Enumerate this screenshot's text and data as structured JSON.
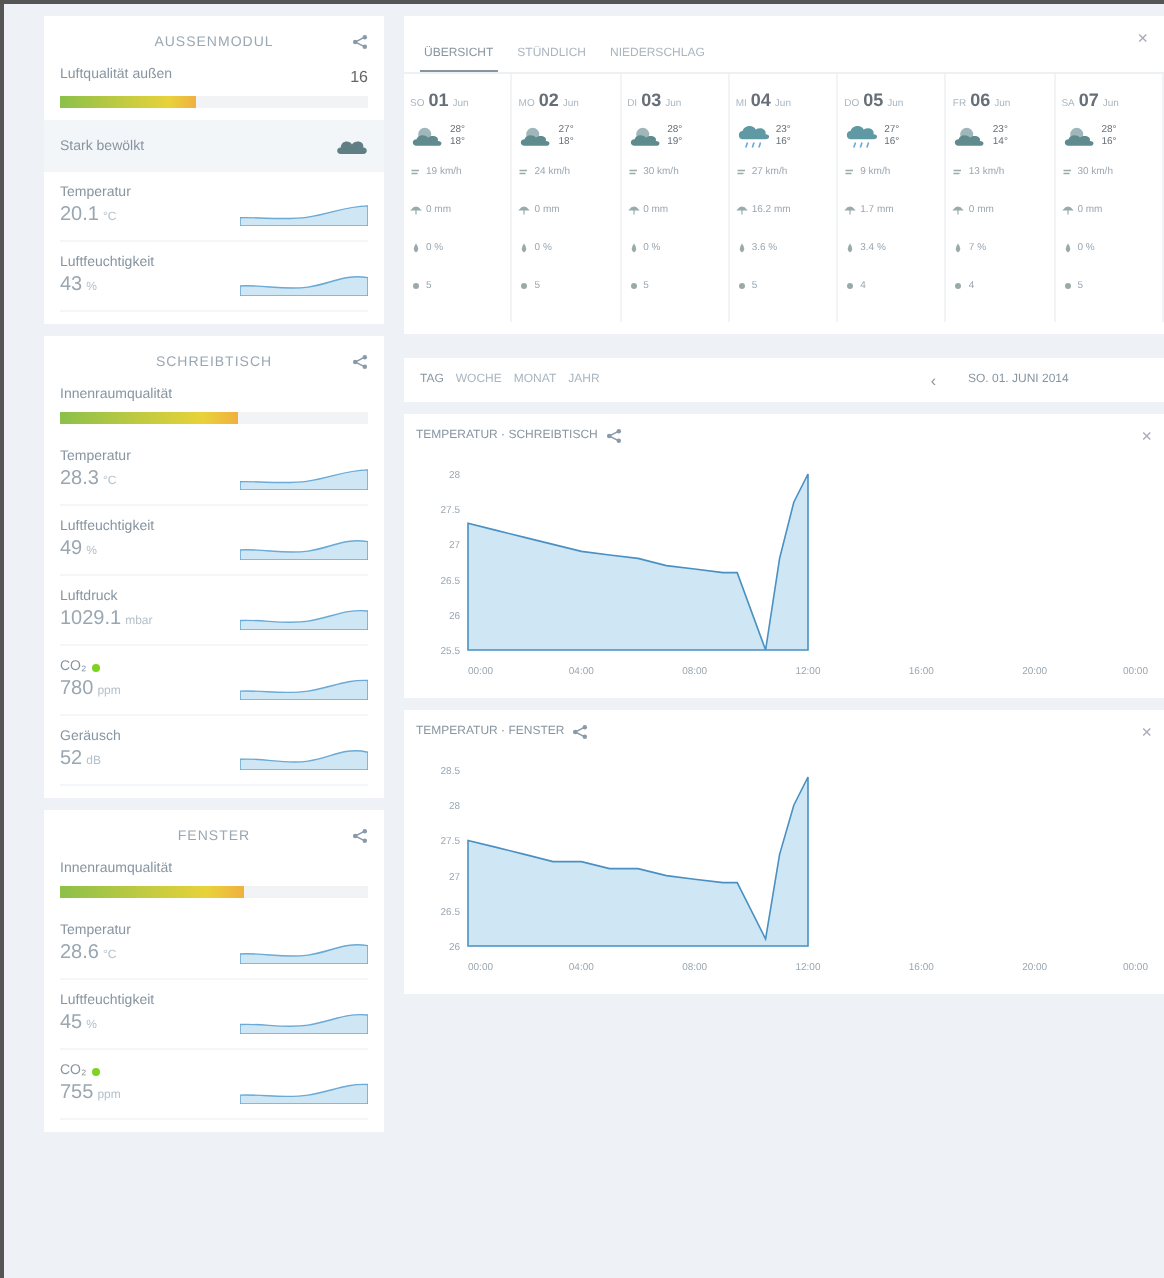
{
  "sidebar": {
    "modules": [
      {
        "title": "AUSSENMODUL",
        "rows": [
          {
            "kind": "bar",
            "label": "Luftqualität außen",
            "value": "16",
            "level": 0.44
          },
          {
            "kind": "weather",
            "label": "Stark bewölkt"
          },
          {
            "kind": "spark",
            "label": "Temperatur",
            "value": "20.1",
            "unit": "°C"
          },
          {
            "kind": "spark",
            "label": "Luftfeuchtigkeit",
            "value": "43",
            "unit": "%"
          }
        ]
      },
      {
        "title": "SCHREIBTISCH",
        "rows": [
          {
            "kind": "bar",
            "label": "Innenraumqualität",
            "level": 0.58
          },
          {
            "kind": "spark",
            "label": "Temperatur",
            "value": "28.3",
            "unit": "°C"
          },
          {
            "kind": "spark",
            "label": "Luftfeuchtigkeit",
            "value": "49",
            "unit": "%"
          },
          {
            "kind": "spark",
            "label": "Luftdruck",
            "value": "1029.1",
            "unit": "mbar"
          },
          {
            "kind": "spark",
            "label": "CO₂",
            "value": "780",
            "unit": "ppm",
            "color": "#7ed321"
          },
          {
            "kind": "spark",
            "label": "Geräusch",
            "value": "52",
            "unit": "dB"
          }
        ]
      },
      {
        "title": "FENSTER",
        "rows": [
          {
            "kind": "bar",
            "label": "Innenraumqualität",
            "level": 0.6
          },
          {
            "kind": "spark",
            "label": "Temperatur",
            "value": "28.6",
            "unit": "°C"
          },
          {
            "kind": "spark",
            "label": "Luftfeuchtigkeit",
            "value": "45",
            "unit": "%"
          },
          {
            "kind": "spark",
            "label": "CO₂",
            "value": "755",
            "unit": "ppm",
            "color": "#7ed321"
          }
        ]
      }
    ]
  },
  "forecast": {
    "tabs": [
      {
        "label": "ÜBERSICHT",
        "selected": true
      },
      {
        "label": "STÜNDLICH",
        "selected": false
      },
      {
        "label": "NIEDERSCHLAG",
        "selected": false
      }
    ],
    "close": "×",
    "days": [
      {
        "weekday": "SO",
        "day": "01",
        "month": "Jun",
        "kind": "cloud",
        "high": "28°",
        "low": "18°",
        "wind": "19 km/h",
        "rain": "0 mm",
        "humidity": "0 %",
        "uv": "5"
      },
      {
        "weekday": "MO",
        "day": "02",
        "month": "Jun",
        "kind": "cloud",
        "high": "27°",
        "low": "18°",
        "wind": "24 km/h",
        "rain": "0 mm",
        "humidity": "0 %",
        "uv": "5"
      },
      {
        "weekday": "DI",
        "day": "03",
        "month": "Jun",
        "kind": "cloud",
        "high": "28°",
        "low": "19°",
        "wind": "30 km/h",
        "rain": "0 mm",
        "humidity": "0 %",
        "uv": "5"
      },
      {
        "weekday": "MI",
        "day": "04",
        "month": "Jun",
        "kind": "rain",
        "high": "23°",
        "low": "16°",
        "wind": "27 km/h",
        "rain": "16.2 mm",
        "humidity": "3.6 %",
        "uv": "5"
      },
      {
        "weekday": "DO",
        "day": "05",
        "month": "Jun",
        "kind": "rain",
        "high": "27°",
        "low": "16°",
        "wind": "9 km/h",
        "rain": "1.7 mm",
        "humidity": "3.4 %",
        "uv": "4"
      },
      {
        "weekday": "FR",
        "day": "06",
        "month": "Jun",
        "kind": "cloud",
        "high": "23°",
        "low": "14°",
        "wind": "13 km/h",
        "rain": "0 mm",
        "humidity": "7 %",
        "uv": "4"
      },
      {
        "weekday": "SA",
        "day": "07",
        "month": "Jun",
        "kind": "cloud",
        "high": "28°",
        "low": "16°",
        "wind": "30 km/h",
        "rain": "0 mm",
        "humidity": "0 %",
        "uv": "5"
      }
    ]
  },
  "range": {
    "tabs": [
      {
        "label": "TAG",
        "selected": true
      },
      {
        "label": "WOCHE",
        "selected": false
      },
      {
        "label": "MONAT",
        "selected": false
      },
      {
        "label": "JAHR",
        "selected": false
      }
    ],
    "prev": "‹",
    "date": "SO. 01. JUNI 2014"
  },
  "charts": [
    {
      "close": "×",
      "chart_data": {
        "type": "area",
        "title": "TEMPERATUR · SCHREIBTISCH",
        "x": [
          0,
          1,
          2,
          3,
          4,
          5,
          6,
          7,
          8,
          9,
          9.5,
          10.5,
          11,
          11.5,
          12
        ],
        "series": [
          {
            "color": "#4a90c2",
            "values": [
              27.3,
              27.2,
              27.1,
              27.0,
              26.9,
              26.85,
              26.8,
              26.7,
              26.65,
              26.6,
              26.6,
              25.5,
              26.8,
              27.6,
              28.0
            ]
          }
        ],
        "xlim": [
          0,
          24
        ],
        "ylim": [
          25.5,
          28
        ],
        "yticks": [
          25.5,
          26,
          26.5,
          27,
          27.5,
          28
        ],
        "xticks": [
          {
            "value": 0,
            "label": "00:00"
          },
          {
            "value": 4,
            "label": "04:00"
          },
          {
            "value": 8,
            "label": "08:00"
          },
          {
            "value": 12,
            "label": "12:00"
          },
          {
            "value": 16,
            "label": "16:00"
          },
          {
            "value": 20,
            "label": "20:00"
          },
          {
            "value": 24,
            "label": "00:00"
          }
        ]
      }
    },
    {
      "close": "×",
      "chart_data": {
        "type": "area",
        "title": "TEMPERATUR · FENSTER",
        "x": [
          0,
          1,
          2,
          3,
          4,
          5,
          6,
          7,
          8,
          9,
          9.5,
          10.5,
          11,
          11.5,
          12
        ],
        "series": [
          {
            "color": "#4a90c2",
            "values": [
              27.5,
              27.4,
              27.3,
              27.2,
              27.2,
              27.1,
              27.1,
              27.0,
              26.95,
              26.9,
              26.9,
              26.1,
              27.3,
              28.0,
              28.4
            ]
          }
        ],
        "xlim": [
          0,
          24
        ],
        "ylim": [
          26,
          28.5
        ],
        "yticks": [
          26,
          26.5,
          27,
          27.5,
          28,
          28.5
        ],
        "xticks": [
          {
            "value": 0,
            "label": "00:00"
          },
          {
            "value": 4,
            "label": "04:00"
          },
          {
            "value": 8,
            "label": "08:00"
          },
          {
            "value": 12,
            "label": "12:00"
          },
          {
            "value": 16,
            "label": "16:00"
          },
          {
            "value": 20,
            "label": "20:00"
          },
          {
            "value": 24,
            "label": "00:00"
          }
        ]
      }
    }
  ]
}
